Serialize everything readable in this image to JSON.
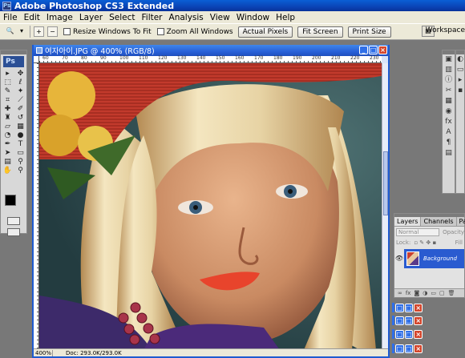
{
  "app": {
    "title": "Adobe Photoshop CS3 Extended"
  },
  "menu": [
    "File",
    "Edit",
    "Image",
    "Layer",
    "Select",
    "Filter",
    "Analysis",
    "View",
    "Window",
    "Help"
  ],
  "options": {
    "resize_windows_label": "Resize Windows To Fit",
    "zoom_all_windows_label": "Zoom All Windows",
    "actual_pixels_label": "Actual Pixels",
    "fit_screen_label": "Fit Screen",
    "print_size_label": "Print Size",
    "workspace_label": "Workspace"
  },
  "document": {
    "title": "여자아이.JPG @ 400% (RGB/8)",
    "ruler_numbers": [
      "60",
      "70",
      "80",
      "90",
      "100",
      "110",
      "120",
      "130",
      "140",
      "150",
      "160",
      "170",
      "180",
      "190",
      "200",
      "210",
      "220",
      "230"
    ],
    "zoom": "400%",
    "doc_info": "Doc: 293.0K/293.0K"
  },
  "tools": {
    "logo": "Ps"
  },
  "layers_panel": {
    "tabs": [
      "Layers",
      "Channels",
      "Path"
    ],
    "blend_mode": "Normal",
    "opacity_label": "Opacity",
    "lock_label": "Lock:",
    "fill_label": "Fill",
    "layer_name": "Background"
  },
  "colors": {
    "accent": "#1f5bd0",
    "hat": "#c83a2e",
    "shirt": "#3d2a6a",
    "background": "#2e4a4e"
  }
}
